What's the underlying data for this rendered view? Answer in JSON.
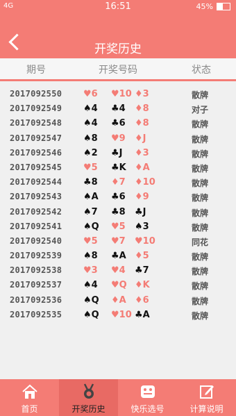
{
  "statusbar": {
    "left": "4G",
    "time": "16:51",
    "battery": "45%"
  },
  "header": {
    "title": "开奖历史"
  },
  "columns": {
    "period": "期号",
    "numbers": "开奖号码",
    "status": "状态"
  },
  "colors": {
    "primary": "#f47c75",
    "red_suit": "#f47c75",
    "black_suit": "#111111"
  },
  "rows": [
    {
      "period": "2017092550",
      "cards": [
        {
          "suit": "♥",
          "rank": "6",
          "color": "red"
        },
        {
          "suit": "♥",
          "rank": "10",
          "color": "red"
        },
        {
          "suit": "♦",
          "rank": "3",
          "color": "red"
        }
      ],
      "status": "散牌"
    },
    {
      "period": "2017092549",
      "cards": [
        {
          "suit": "♠",
          "rank": "4",
          "color": "black"
        },
        {
          "suit": "♣",
          "rank": "4",
          "color": "black"
        },
        {
          "suit": "♦",
          "rank": "8",
          "color": "red"
        }
      ],
      "status": "对子"
    },
    {
      "period": "2017092548",
      "cards": [
        {
          "suit": "♠",
          "rank": "4",
          "color": "black"
        },
        {
          "suit": "♣",
          "rank": "6",
          "color": "black"
        },
        {
          "suit": "♦",
          "rank": "8",
          "color": "red"
        }
      ],
      "status": "散牌"
    },
    {
      "period": "2017092547",
      "cards": [
        {
          "suit": "♠",
          "rank": "8",
          "color": "black"
        },
        {
          "suit": "♥",
          "rank": "9",
          "color": "red"
        },
        {
          "suit": "♦",
          "rank": "J",
          "color": "red"
        }
      ],
      "status": "散牌"
    },
    {
      "period": "2017092546",
      "cards": [
        {
          "suit": "♠",
          "rank": "2",
          "color": "black"
        },
        {
          "suit": "♣",
          "rank": "J",
          "color": "black"
        },
        {
          "suit": "♦",
          "rank": "3",
          "color": "red"
        }
      ],
      "status": "散牌"
    },
    {
      "period": "2017092545",
      "cards": [
        {
          "suit": "♥",
          "rank": "5",
          "color": "red"
        },
        {
          "suit": "♣",
          "rank": "K",
          "color": "black"
        },
        {
          "suit": "♦",
          "rank": "A",
          "color": "red"
        }
      ],
      "status": "散牌"
    },
    {
      "period": "2017092544",
      "cards": [
        {
          "suit": "♣",
          "rank": "8",
          "color": "black"
        },
        {
          "suit": "♦",
          "rank": "7",
          "color": "red"
        },
        {
          "suit": "♦",
          "rank": "10",
          "color": "red"
        }
      ],
      "status": "散牌"
    },
    {
      "period": "2017092543",
      "cards": [
        {
          "suit": "♠",
          "rank": "A",
          "color": "black"
        },
        {
          "suit": "♣",
          "rank": "6",
          "color": "black"
        },
        {
          "suit": "♦",
          "rank": "9",
          "color": "red"
        }
      ],
      "status": "散牌"
    },
    {
      "period": "2017092542",
      "cards": [
        {
          "suit": "♠",
          "rank": "7",
          "color": "black"
        },
        {
          "suit": "♣",
          "rank": "8",
          "color": "black"
        },
        {
          "suit": "♣",
          "rank": "J",
          "color": "black"
        }
      ],
      "status": "散牌"
    },
    {
      "period": "2017092541",
      "cards": [
        {
          "suit": "♠",
          "rank": "Q",
          "color": "black"
        },
        {
          "suit": "♥",
          "rank": "5",
          "color": "red"
        },
        {
          "suit": "♠",
          "rank": "3",
          "color": "black"
        }
      ],
      "status": "散牌"
    },
    {
      "period": "2017092540",
      "cards": [
        {
          "suit": "♥",
          "rank": "5",
          "color": "red"
        },
        {
          "suit": "♥",
          "rank": "7",
          "color": "red"
        },
        {
          "suit": "♥",
          "rank": "10",
          "color": "red"
        }
      ],
      "status": "同花"
    },
    {
      "period": "2017092539",
      "cards": [
        {
          "suit": "♠",
          "rank": "8",
          "color": "black"
        },
        {
          "suit": "♣",
          "rank": "A",
          "color": "black"
        },
        {
          "suit": "♦",
          "rank": "5",
          "color": "red"
        }
      ],
      "status": "散牌"
    },
    {
      "period": "2017092538",
      "cards": [
        {
          "suit": "♥",
          "rank": "3",
          "color": "red"
        },
        {
          "suit": "♥",
          "rank": "4",
          "color": "red"
        },
        {
          "suit": "♣",
          "rank": "7",
          "color": "black"
        }
      ],
      "status": "散牌"
    },
    {
      "period": "2017092537",
      "cards": [
        {
          "suit": "♠",
          "rank": "4",
          "color": "black"
        },
        {
          "suit": "♥",
          "rank": "Q",
          "color": "red"
        },
        {
          "suit": "♦",
          "rank": "K",
          "color": "red"
        }
      ],
      "status": "散牌"
    },
    {
      "period": "2017092536",
      "cards": [
        {
          "suit": "♠",
          "rank": "Q",
          "color": "black"
        },
        {
          "suit": "♦",
          "rank": "A",
          "color": "red"
        },
        {
          "suit": "♦",
          "rank": "6",
          "color": "red"
        }
      ],
      "status": "散牌"
    },
    {
      "period": "2017092535",
      "cards": [
        {
          "suit": "♠",
          "rank": "Q",
          "color": "black"
        },
        {
          "suit": "♥",
          "rank": "10",
          "color": "red"
        },
        {
          "suit": "♣",
          "rank": "A",
          "color": "black"
        }
      ],
      "status": "散牌"
    }
  ],
  "tabs": [
    {
      "label": "首页",
      "icon": "home-icon",
      "active": false
    },
    {
      "label": "开奖历史",
      "icon": "medal-icon",
      "active": true
    },
    {
      "label": "快乐选号",
      "icon": "dice-icon",
      "active": false
    },
    {
      "label": "计算说明",
      "icon": "edit-icon",
      "active": false
    }
  ]
}
